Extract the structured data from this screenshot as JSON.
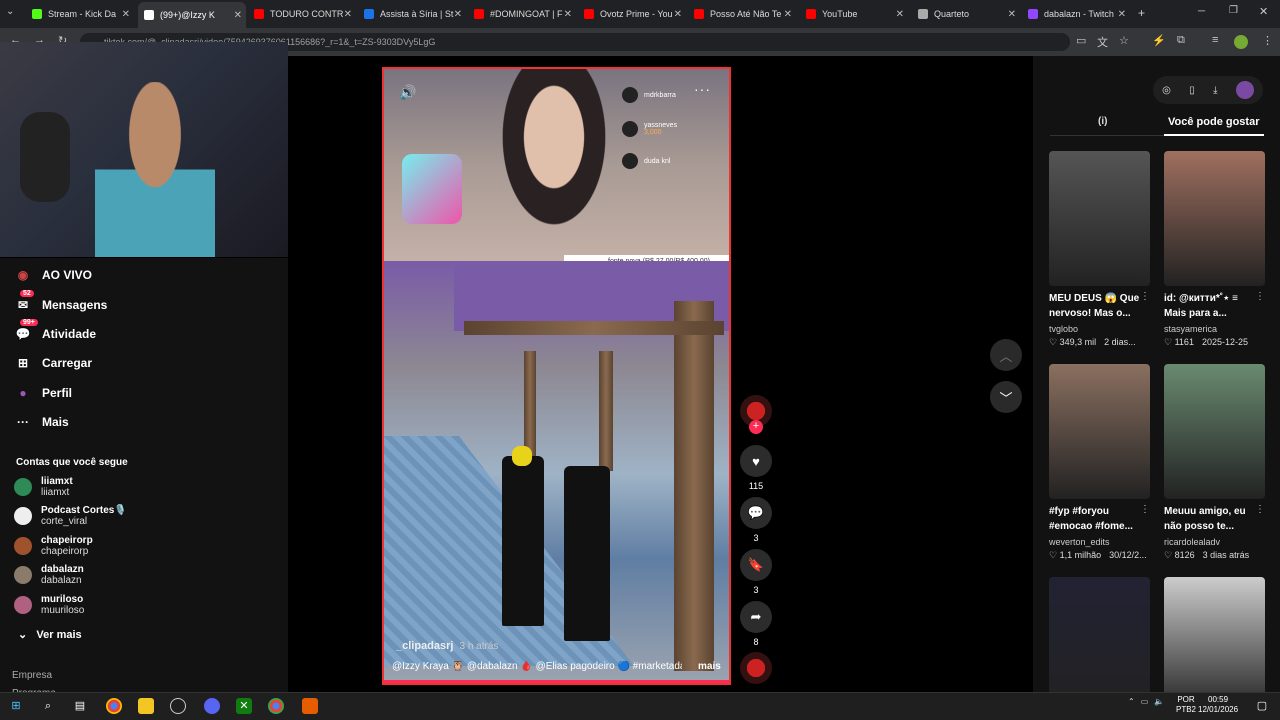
{
  "browser": {
    "tabs": [
      {
        "label": "Stream - Kick Da",
        "color": "#53fc18"
      },
      {
        "label": "(99+)@Izzy K",
        "color": "#ffffff"
      },
      {
        "label": "TODURO CONTR",
        "color": "#ff0000"
      },
      {
        "label": "Assista à Síria | St",
        "color": "#1a73e8"
      },
      {
        "label": "#DOMINGOAT | F",
        "color": "#ff0000"
      },
      {
        "label": "Ovotz Prime - You",
        "color": "#ff0000"
      },
      {
        "label": "Posso Até Não Te",
        "color": "#ff0000"
      },
      {
        "label": "YouTube",
        "color": "#ff0000"
      },
      {
        "label": "Quarteto",
        "color": "#aaaaaa"
      },
      {
        "label": "dabalazn - Twitch",
        "color": "#9146ff"
      }
    ],
    "url": "tiktok.com/@_clipadasrj/video/7594269376061156686?_r=1&_t=ZS-9303DVy5LgG"
  },
  "sidebar": {
    "nav": [
      {
        "label": "AO VIVO",
        "icon": "live-icon"
      },
      {
        "label": "Mensagens",
        "icon": "message-icon",
        "badge": "52"
      },
      {
        "label": "Atividade",
        "icon": "activity-icon",
        "badge": "99+"
      },
      {
        "label": "Carregar",
        "icon": "upload-icon"
      },
      {
        "label": "Perfil",
        "icon": "profile-icon"
      },
      {
        "label": "Mais",
        "icon": "more-icon"
      }
    ],
    "following_heading": "Contas que você segue",
    "accounts": [
      {
        "name": "liiamxt",
        "handle": "liiamxt",
        "color": "#2e8b57"
      },
      {
        "name": "Podcast Cortes🎙️",
        "handle": "corte_viral",
        "color": "#eeeeee"
      },
      {
        "name": "chapeirorp",
        "handle": "chapeirorp",
        "color": "#a0522d"
      },
      {
        "name": "dabalazn",
        "handle": "dabalazn",
        "color": "#8b7b6b"
      },
      {
        "name": "muriloso",
        "handle": "muuriloso",
        "color": "#b06080"
      }
    ],
    "see_more": "Ver mais",
    "footer": [
      "Empresa",
      "Programa"
    ]
  },
  "video": {
    "chat": [
      {
        "name": "mdrkbarra",
        "text": ""
      },
      {
        "name": "yassneves",
        "text": "3,000"
      },
      {
        "name": "duda knl",
        "text": ""
      }
    ],
    "donation_bar": "fonte nova (R$ 27,00/R$ 400,00)",
    "author": "_clipadasrj",
    "time": "3 h atrás",
    "caption": "@Izzy Kraya 🦉 @dabalazn 🩸 @Elias pagodeiro 🔵 #marketada —",
    "more": "mais",
    "progress": 1.0
  },
  "actions": {
    "likes": "115",
    "comments": "3",
    "saves": "3",
    "shares": "8"
  },
  "right": {
    "tab_info": "(i)",
    "tab_rec": "Você pode gostar",
    "cards": [
      {
        "title": "MEU DEUS 😱 Que nervoso! Mas o...",
        "author": "tvglobo",
        "likes": "349,3 mil",
        "date": "2 dias...",
        "thumb": "#555"
      },
      {
        "title": "id: @китти*˚⋆ ≡ Mais para a...",
        "author": "stasyamerica",
        "likes": "1161",
        "date": "2025-12-25",
        "thumb": "#a07060"
      },
      {
        "title": "#fyp #foryou #emocao #fome...",
        "author": "weverton_edits",
        "likes": "1,1 milhão",
        "date": "30/12/2...",
        "thumb": "#8a7060"
      },
      {
        "title": "Meuuu amigo, eu não posso te...",
        "author": "ricardolealadv",
        "likes": "8126",
        "date": "3 dias atrás",
        "thumb": "#6a8a70"
      },
      {
        "title": "",
        "author": "",
        "likes": "",
        "date": "",
        "thumb": "#223"
      },
      {
        "title": "",
        "author": "",
        "likes": "",
        "date": "",
        "thumb": "#ccc"
      }
    ]
  },
  "taskbar": {
    "lang": "POR\nPTB2",
    "time": "00:59",
    "date": "12/01/2026"
  }
}
